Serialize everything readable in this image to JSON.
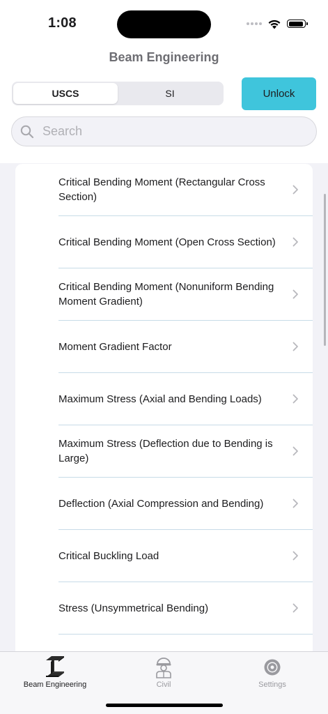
{
  "status_bar": {
    "time": "1:08"
  },
  "nav": {
    "title": "Beam Engineering"
  },
  "units": {
    "options": [
      "USCS",
      "SI"
    ],
    "selected": "USCS"
  },
  "unlock_label": "Unlock",
  "search": {
    "placeholder": "Search",
    "value": ""
  },
  "list": {
    "items": [
      {
        "label": "Critical Bending Moment (Rectangular Cross Section)"
      },
      {
        "label": "Critical Bending Moment (Open Cross Section)"
      },
      {
        "label": "Critical Bending Moment (Nonuniform Bending Moment Gradient)"
      },
      {
        "label": "Moment Gradient Factor"
      },
      {
        "label": "Maximum Stress (Axial and Bending Loads)"
      },
      {
        "label": "Maximum Stress (Deflection due to Bending is Large)"
      },
      {
        "label": "Deflection (Axial Compression and Bending)"
      },
      {
        "label": "Critical Buckling Load"
      },
      {
        "label": "Stress (Unsymmetrical Bending)"
      }
    ]
  },
  "tab_bar": {
    "tabs": [
      {
        "label": "Beam Engineering",
        "icon": "i-beam-icon",
        "selected": true
      },
      {
        "label": "Civil",
        "icon": "worker-helmet-icon",
        "selected": false
      },
      {
        "label": "Settings",
        "icon": "gear-icon",
        "selected": false
      }
    ]
  },
  "colors": {
    "accent": "#3fc5dc",
    "separator": "#c7dbe7",
    "background": "#f2f2f7"
  }
}
